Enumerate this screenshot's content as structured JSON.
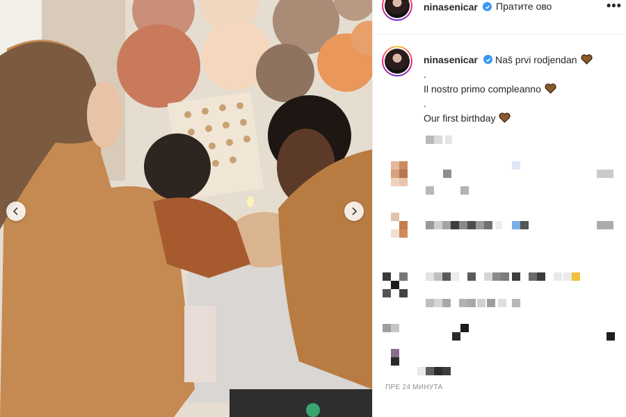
{
  "post": {
    "username": "ninasenicar",
    "follow_label": "Пратите ово",
    "more_label": "•••",
    "caption_lines": [
      "Naš prvi rodjendan",
      ".",
      "Il nostro primo compleanno",
      ".",
      "Our first birthday"
    ],
    "timestamp": "ПРЕ 24 МИНУТА"
  },
  "icons": {
    "verified": "verified-badge-icon",
    "heart": "brown-heart-icon",
    "prev": "chevron-left-icon",
    "next": "chevron-right-icon"
  },
  "colors": {
    "verified_blue": "#3897f0",
    "heart_brown": "#8b5a2b",
    "muted_text": "#8e8e8e"
  }
}
